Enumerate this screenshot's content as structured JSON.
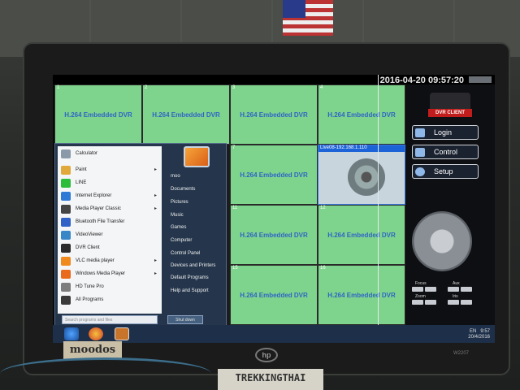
{
  "topbar": {
    "datetime": "2016-04-20 09:57:20"
  },
  "grid": {
    "cells": [
      {
        "num": "1",
        "label": "H.264 Embedded DVR"
      },
      {
        "num": "2",
        "label": "H.264 Embedded DVR"
      },
      {
        "num": "3",
        "label": "H.264 Embedded DVR"
      },
      {
        "num": "4",
        "label": "H.264 Embedded DVR"
      },
      {
        "num": "7",
        "label": "H.264 Embedded DVR"
      },
      {
        "num": "11",
        "label": "H.264 Embedded DVR"
      },
      {
        "num": "12",
        "label": "H.264 Embedded DVR"
      },
      {
        "num": "15",
        "label": "H.264 Embedded DVR"
      },
      {
        "num": "16",
        "label": "H.264 Embedded DVR"
      }
    ],
    "live": {
      "num": "8",
      "title": "Live08-192.168.1.110"
    }
  },
  "rightpanel": {
    "logo": "DVR CLIENT",
    "buttons": [
      {
        "label": "Login",
        "icon": "user-icon"
      },
      {
        "label": "Control",
        "icon": "monitor-icon"
      },
      {
        "label": "Setup",
        "icon": "gear-icon"
      }
    ],
    "ptz": {
      "focus": "Focus",
      "aux": "Aux",
      "zoom": "Zoom",
      "iris": "Iris"
    }
  },
  "startmenu": {
    "left_items": [
      {
        "label": "Calculator",
        "icon": "calculator-icon",
        "color": "#8a9aa8",
        "submenu": false
      },
      {
        "label": "Paint",
        "icon": "paint-icon",
        "color": "#e0a93a",
        "submenu": true
      },
      {
        "label": "LINE",
        "icon": "line-icon",
        "color": "#2cbd3a",
        "submenu": false
      },
      {
        "label": "Internet Explorer",
        "icon": "ie-icon",
        "color": "#2d7ad6",
        "submenu": true
      },
      {
        "label": "Media Player Classic",
        "icon": "media-player-icon",
        "color": "#444444",
        "submenu": true
      },
      {
        "label": "Bluetooth File Transfer",
        "icon": "bluetooth-icon",
        "color": "#2f61c6",
        "submenu": false
      },
      {
        "label": "VideoViewer",
        "icon": "videoviewer-icon",
        "color": "#3a87c8",
        "submenu": false
      },
      {
        "label": "DVR Client",
        "icon": "dvr-client-icon",
        "color": "#2b2b2b",
        "submenu": false
      },
      {
        "label": "VLC media player",
        "icon": "vlc-icon",
        "color": "#f08a1c",
        "submenu": true
      },
      {
        "label": "Windows Media Player",
        "icon": "wmp-icon",
        "color": "#e86a1a",
        "submenu": true
      },
      {
        "label": "HD Tune Pro",
        "icon": "hdtune-icon",
        "color": "#7d7d7d",
        "submenu": false
      },
      {
        "label": "All Programs",
        "icon": "arrow-right-icon",
        "color": "#3a3a3a",
        "submenu": false
      }
    ],
    "search_placeholder": "Search programs and files",
    "user": "moo",
    "right_items": [
      "Documents",
      "Pictures",
      "Music",
      "Games",
      "Computer",
      "Control Panel",
      "Devices and Printers",
      "Default Programs",
      "Help and Support"
    ],
    "shutdown": "Shut down"
  },
  "taskbar": {
    "lang": "EN",
    "time": "9:57",
    "date": "20/4/2016"
  },
  "photo": {
    "sticker": "moodos",
    "brand": "hp",
    "model": "W2207",
    "label": "TREKKINGTHAI"
  }
}
